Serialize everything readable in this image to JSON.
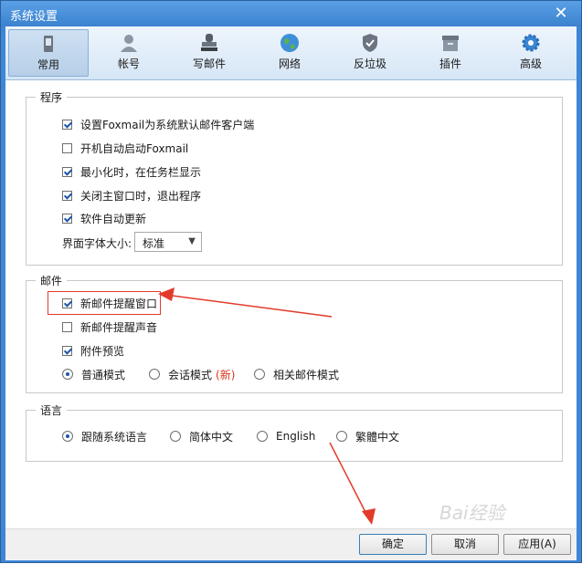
{
  "window": {
    "title": "系统设置"
  },
  "toolbar": {
    "tabs": [
      {
        "label": "常用",
        "icon": "phone-icon"
      },
      {
        "label": "帐号",
        "icon": "user-icon"
      },
      {
        "label": "写邮件",
        "icon": "stamp-icon"
      },
      {
        "label": "网络",
        "icon": "globe-icon"
      },
      {
        "label": "反垃圾",
        "icon": "shield-icon"
      },
      {
        "label": "插件",
        "icon": "box-icon"
      },
      {
        "label": "高级",
        "icon": "gear-icon"
      }
    ],
    "selected": "常用"
  },
  "program": {
    "title": "程序",
    "options": [
      {
        "label": "设置Foxmail为系统默认邮件客户端",
        "checked": true
      },
      {
        "label": "开机自动启动Foxmail",
        "checked": false
      },
      {
        "label": "最小化时，在任务栏显示",
        "checked": true
      },
      {
        "label": "关闭主窗口时，退出程序",
        "checked": true
      },
      {
        "label": "软件自动更新",
        "checked": true
      }
    ],
    "font_size_label": "界面字体大小:",
    "font_size_value": "标准"
  },
  "mail": {
    "title": "邮件",
    "options": [
      {
        "label": "新邮件提醒窗口",
        "checked": true
      },
      {
        "label": "新邮件提醒声音",
        "checked": false
      },
      {
        "label": "附件预览",
        "checked": true
      }
    ],
    "modes": [
      {
        "label": "普通模式",
        "selected": true
      },
      {
        "label": "会话模式",
        "selected": false
      },
      {
        "label": "相关邮件模式",
        "selected": false
      }
    ],
    "new_badge": "(新)"
  },
  "language": {
    "title": "语言",
    "options": [
      {
        "label": "跟随系统语言",
        "selected": true
      },
      {
        "label": "简体中文",
        "selected": false
      },
      {
        "label": "English",
        "selected": false
      },
      {
        "label": "繁體中文",
        "selected": false
      }
    ]
  },
  "buttons": {
    "ok": "确定",
    "cancel": "取消",
    "apply": "应用(A)"
  },
  "watermark": "Bai经验",
  "colors": {
    "titlebar": "#3b82cf",
    "annotation": "#e23b2b",
    "checkmark": "#1d56a8"
  }
}
